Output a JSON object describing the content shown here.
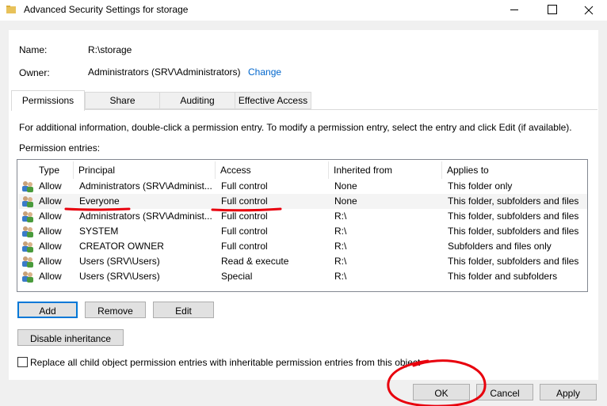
{
  "window": {
    "title": "Advanced Security Settings for storage"
  },
  "info": {
    "name_label": "Name:",
    "name_value": "R:\\storage",
    "owner_label": "Owner:",
    "owner_value": "Administrators (SRV\\Administrators)",
    "change_link": "Change"
  },
  "tabs": [
    {
      "label": "Permissions",
      "active": true
    },
    {
      "label": "Share",
      "active": false
    },
    {
      "label": "Auditing",
      "active": false
    },
    {
      "label": "Effective Access",
      "active": false
    }
  ],
  "permissions": {
    "help_text": "For additional information, double-click a permission entry. To modify a permission entry, select the entry and click Edit (if available).",
    "entries_label": "Permission entries:",
    "columns": [
      "Type",
      "Principal",
      "Access",
      "Inherited from",
      "Applies to"
    ],
    "rows": [
      {
        "type": "Allow",
        "principal": "Administrators (SRV\\Administ...",
        "access": "Full control",
        "inherited": "None",
        "applies": "This folder only"
      },
      {
        "type": "Allow",
        "principal": "Everyone",
        "access": "Full control",
        "inherited": "None",
        "applies": "This folder, subfolders and files"
      },
      {
        "type": "Allow",
        "principal": "Administrators (SRV\\Administ...",
        "access": "Full control",
        "inherited": "R:\\",
        "applies": "This folder, subfolders and files"
      },
      {
        "type": "Allow",
        "principal": "SYSTEM",
        "access": "Full control",
        "inherited": "R:\\",
        "applies": "This folder, subfolders and files"
      },
      {
        "type": "Allow",
        "principal": "CREATOR OWNER",
        "access": "Full control",
        "inherited": "R:\\",
        "applies": "Subfolders and files only"
      },
      {
        "type": "Allow",
        "principal": "Users (SRV\\Users)",
        "access": "Read & execute",
        "inherited": "R:\\",
        "applies": "This folder, subfolders and files"
      },
      {
        "type": "Allow",
        "principal": "Users (SRV\\Users)",
        "access": "Special",
        "inherited": "R:\\",
        "applies": "This folder and subfolders"
      }
    ],
    "selected_row": 1
  },
  "buttons": {
    "add": "Add",
    "remove": "Remove",
    "edit": "Edit",
    "disable_inheritance": "Disable inheritance",
    "replace_checkbox": "Replace all child object permission entries with inheritable permission entries from this object",
    "ok": "OK",
    "cancel": "Cancel",
    "apply": "Apply"
  },
  "colors": {
    "link": "#0066cc",
    "annotation": "#e8000d",
    "default_button_border": "#0078d7"
  }
}
